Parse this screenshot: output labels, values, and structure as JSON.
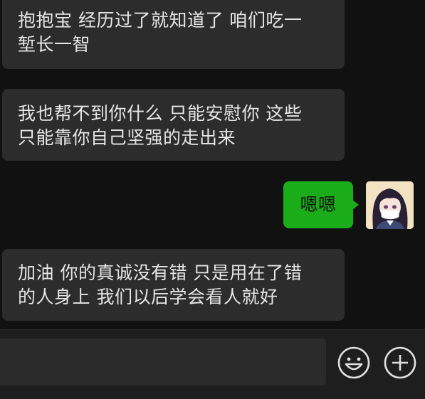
{
  "messages": [
    {
      "direction": "incoming",
      "lines": [
        "抱抱宝 经历过了就知道了 咱们吃一",
        "堑长一智"
      ]
    },
    {
      "direction": "incoming",
      "lines": [
        "我也帮不到你什么 只能安慰你 这些",
        "只能靠你自己坚强的走出来"
      ]
    },
    {
      "direction": "outgoing",
      "lines": [
        "嗯嗯"
      ]
    },
    {
      "direction": "incoming",
      "lines": [
        "加油 你的真诚没有错 只是用在了错",
        "的人身上 我们以后学会看人就好"
      ]
    }
  ],
  "input": {
    "value": "",
    "placeholder": ""
  },
  "icons": {
    "emoji": "smiley-face-icon",
    "more": "plus-circle-icon"
  },
  "colors": {
    "background": "#111111",
    "incoming_bubble": "#2c2c2c",
    "outgoing_bubble": "#1aad19",
    "input_bar": "#1e1e1e",
    "icon": "#e0e0e0"
  }
}
